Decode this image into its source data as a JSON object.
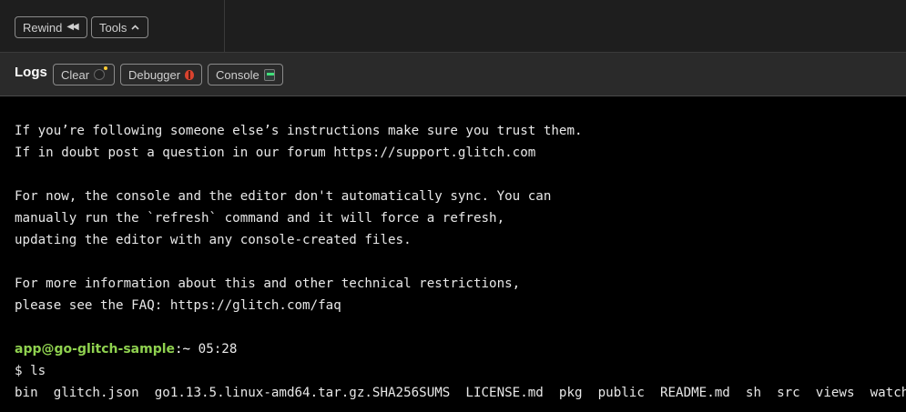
{
  "toolbar": {
    "rewind_label": "Rewind",
    "rewind_icon": "◀◀",
    "tools_label": "Tools",
    "tools_icon": "^"
  },
  "logs_bar": {
    "title": "Logs",
    "clear_label": "Clear",
    "debugger_label": "Debugger",
    "console_label": "Console"
  },
  "terminal": {
    "lines": [
      "If you’re following someone else’s instructions make sure you trust them.",
      "If in doubt post a question in our forum https://support.glitch.com",
      "For now, the console and the editor don't automatically sync. You can",
      "manually run the `refresh` command and it will force a refresh,",
      "updating the editor with any console-created files.",
      "For more information about this and other technical restrictions,",
      "please see the FAQ: https://glitch.com/faq"
    ],
    "prompt_user": "app@go-glitch-sample",
    "prompt_sep": ":~",
    "prompt_time": " 05:28",
    "command": "$ ls",
    "ls_output": "bin  glitch.json  go1.13.5.linux-amd64.tar.gz.SHA256SUMS  LICENSE.md  pkg  public  README.md  sh  src  views  watch.json"
  }
}
